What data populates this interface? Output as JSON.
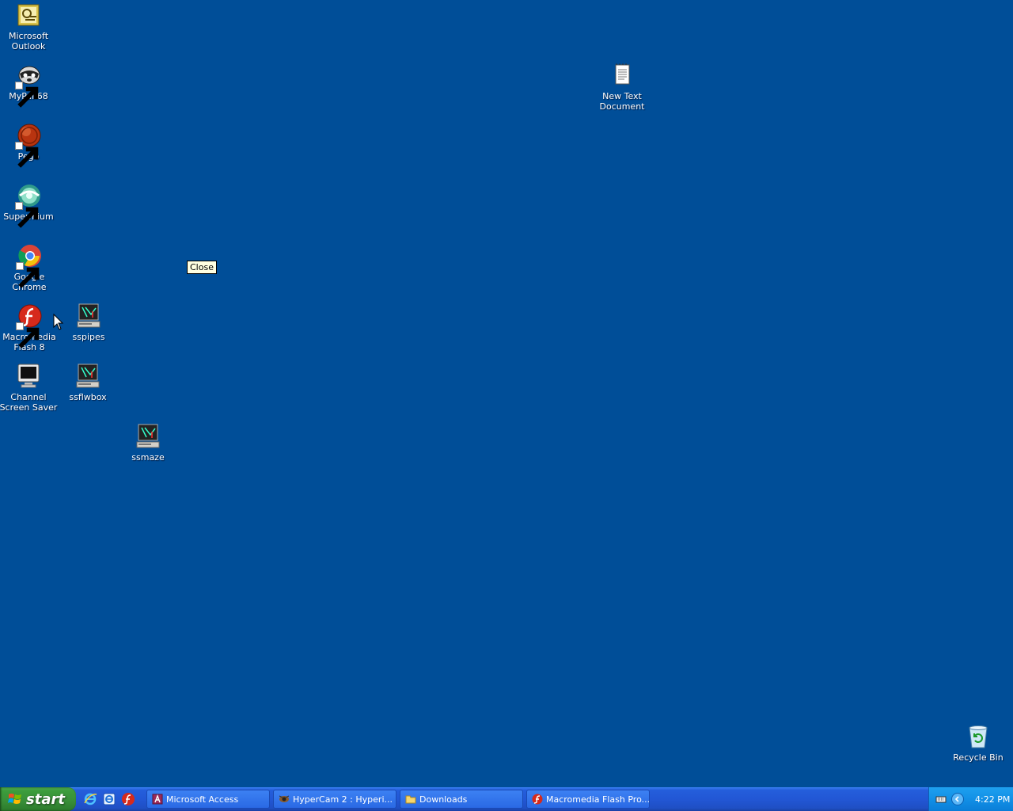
{
  "desktop": {
    "icons": [
      {
        "label": "Microsoft Outlook",
        "icon": "outlook-icon"
      },
      {
        "label": "MyPal 68",
        "icon": "mypal-icon"
      },
      {
        "label": "Pego",
        "icon": "pego-icon"
      },
      {
        "label": "Supermium",
        "icon": "supermium-icon"
      },
      {
        "label": "Google Chrome",
        "icon": "chrome-icon"
      },
      {
        "label": "Macromedia Flash 8",
        "icon": "flash-icon"
      },
      {
        "label": "sspipes",
        "icon": "screensaver-icon"
      },
      {
        "label": "Channel Screen Saver",
        "icon": "monitor-icon"
      },
      {
        "label": "ssflwbox",
        "icon": "screensaver-icon"
      },
      {
        "label": "ssmaze",
        "icon": "screensaver-icon"
      },
      {
        "label": "New Text Document",
        "icon": "notepad-icon"
      },
      {
        "label": "Recycle Bin",
        "icon": "recycle-bin-icon"
      }
    ],
    "tooltip": "Close"
  },
  "taskbar": {
    "start_label": "start",
    "quick_launch": [
      "ie-icon",
      "ie-alt-icon",
      "flash-icon"
    ],
    "tasks": [
      {
        "label": "Microsoft Access",
        "icon": "access-icon"
      },
      {
        "label": "HyperCam 2 : Hyperi...",
        "icon": "hypercam-icon"
      },
      {
        "label": "Downloads",
        "icon": "folder-icon"
      },
      {
        "label": "Macromedia Flash Pro...",
        "icon": "flash-icon"
      }
    ],
    "tray": {
      "clock": "4:22 PM"
    }
  },
  "colors": {
    "desktop_bg": "#004e98",
    "taskbar_blue": "#245edb",
    "start_green": "#3c9d3c",
    "tray_blue": "#1290e6"
  }
}
